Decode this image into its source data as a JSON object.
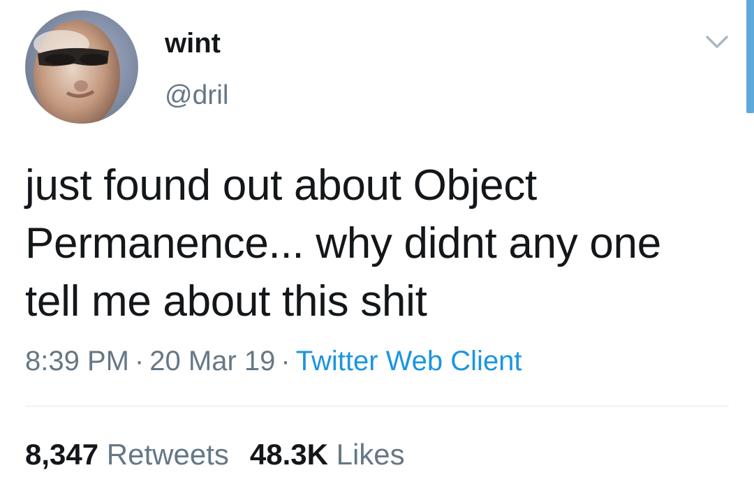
{
  "user": {
    "display_name": "wint",
    "handle": "@dril",
    "avatar_icon": "avatar-photo"
  },
  "menu": {
    "icon": "chevron-down-icon"
  },
  "tweet": {
    "lines": [
      "just found out about Object",
      "Permanence... why didnt any one",
      "tell me about this shit"
    ],
    "time": "8:39 PM",
    "date": "20 Mar 19",
    "separator": "·",
    "source": "Twitter Web Client"
  },
  "stats": {
    "retweets_count": "8,347",
    "retweets_label": "Retweets",
    "likes_count": "48.3K",
    "likes_label": "Likes"
  },
  "colors": {
    "text": "#14171a",
    "secondary": "#657786",
    "link": "#1b95e0",
    "divider": "#e1e8ed",
    "scrollbar": "#5ea9dd"
  }
}
